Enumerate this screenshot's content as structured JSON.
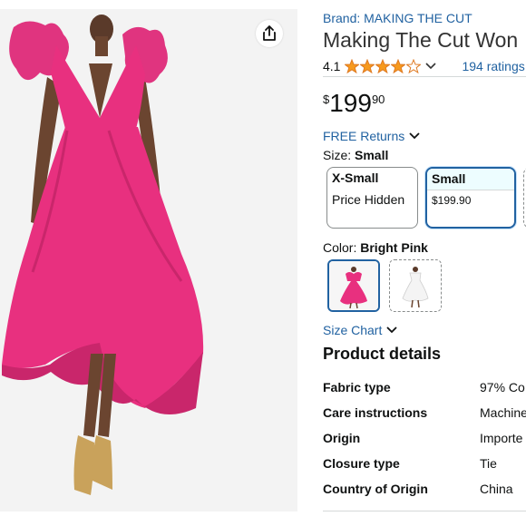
{
  "brand": {
    "label": "Brand: MAKING THE CUT"
  },
  "product": {
    "title": "Making The Cut Won"
  },
  "rating": {
    "value": "4.1",
    "stars": 4.1,
    "count": "194 ratings"
  },
  "price": {
    "symbol": "$",
    "whole": "199",
    "fraction": "90"
  },
  "returns": {
    "label": "FREE Returns"
  },
  "size": {
    "label": "Size:",
    "selected": "Small",
    "options": [
      {
        "name": "X-Small",
        "detail": "Price Hidden"
      },
      {
        "name": "Small",
        "detail": "$199.90"
      }
    ]
  },
  "color": {
    "label": "Color:",
    "selected": "Bright Pink"
  },
  "size_chart": {
    "label": "Size Chart"
  },
  "details": {
    "heading": "Product details",
    "rows": [
      {
        "key": "Fabric type",
        "value": "97% Co"
      },
      {
        "key": "Care instructions",
        "value": "Machine"
      },
      {
        "key": "Origin",
        "value": "Importe"
      },
      {
        "key": "Closure type",
        "value": "Tie"
      },
      {
        "key": "Country of Origin",
        "value": "China"
      }
    ]
  },
  "colors": {
    "link": "#2162a1",
    "star": "#f79a1d",
    "dress": "#e8307f",
    "selected_border": "#2162a1"
  },
  "icons": {
    "share": "share-icon",
    "chevron": "chevron-down-icon",
    "star": "star-icon"
  }
}
